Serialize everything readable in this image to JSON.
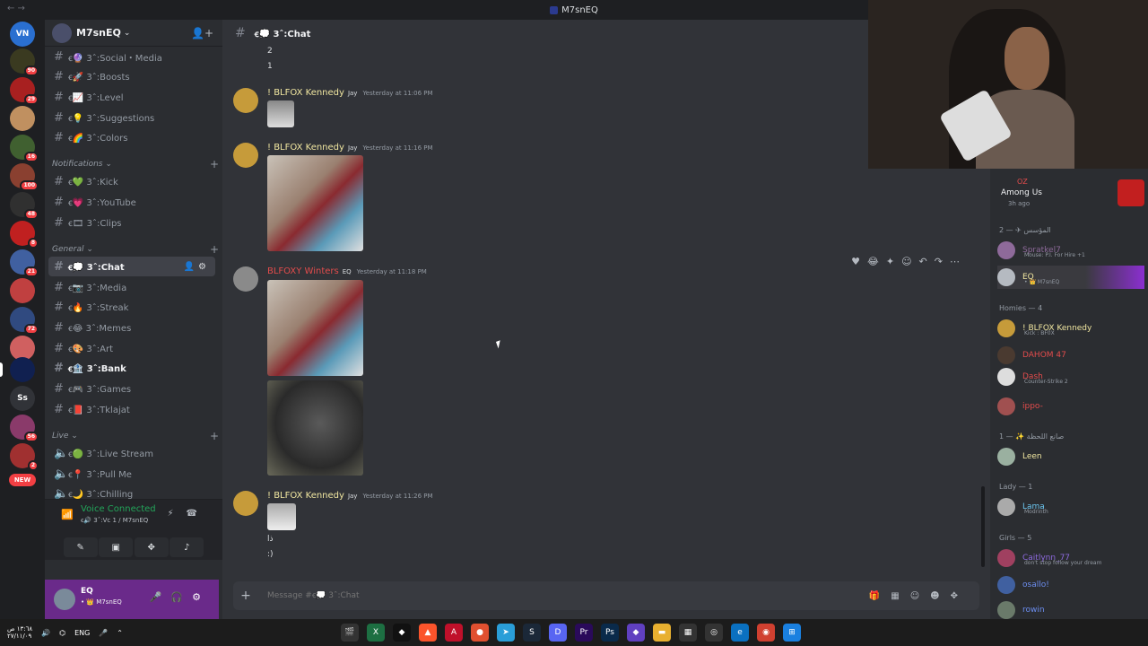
{
  "window": {
    "title": "M7snEQ"
  },
  "server": {
    "name": "M7snEQ"
  },
  "rail": {
    "badges": [
      "90",
      "29",
      "16",
      "100",
      "48",
      "8",
      "21",
      "72",
      "56",
      "2",
      "NEW"
    ],
    "ss": "Ss"
  },
  "channels": [
    {
      "name": "ꞓ🔮 3ˆ:Social・Media"
    },
    {
      "name": "ꞓ🚀 3ˆ:Boosts"
    },
    {
      "name": "ꞓ📈 3ˆ:Level"
    },
    {
      "name": "ꞓ💡 3ˆ:Suggestions"
    },
    {
      "name": "ꞓ🌈 3ˆ:Colors"
    }
  ],
  "categories": {
    "notifications": "Notifications",
    "general": "General",
    "live": "Live"
  },
  "notif_channels": [
    {
      "name": "ꞓ💚 3ˆ:Kick"
    },
    {
      "name": "ꞓ💗 3ˆ:YouTube"
    },
    {
      "name": "ꞓ🎞 3ˆ:Clips"
    }
  ],
  "general_channels": [
    {
      "name": "ꞓ💭 3ˆ:Chat"
    },
    {
      "name": "ꞓ📷 3ˆ:Media"
    },
    {
      "name": "ꞓ🔥 3ˆ:Streak"
    },
    {
      "name": "ꞓ😂 3ˆ:Memes"
    },
    {
      "name": "ꞓ🎨 3ˆ:Art"
    },
    {
      "name": "ꞓ🏦 3ˆ:Bank"
    },
    {
      "name": "ꞓ🎮 3ˆ:Games"
    },
    {
      "name": "ꞓ📕 3ˆ:Tklajat"
    }
  ],
  "live_channels": [
    {
      "name": "ꞓ🟢 3ˆ:Live Stream"
    },
    {
      "name": "ꞓ📍 3ˆ:Pull Me"
    },
    {
      "name": "ꞓ🌙 3ˆ:Chilling"
    }
  ],
  "voice": {
    "title": "Voice Connected",
    "sub": "ꞓ🔊 3ˆ:Vc 1 / M7snEQ"
  },
  "user": {
    "name": "EQ",
    "sub": "• 👑 M7snEQ"
  },
  "chat": {
    "header": "ꞓ💭 3ˆ:Chat",
    "top_lines": [
      "2",
      "1"
    ],
    "messages": [
      {
        "author": "! BLFOX Kennedy",
        "tag": "Jay",
        "time": "Yesterday at 11:06 PM"
      },
      {
        "author": "! BLFOX Kennedy",
        "tag": "Jay",
        "time": "Yesterday at 11:16 PM"
      },
      {
        "author": "BLFOXY Winters",
        "tag": "EQ",
        "time": "Yesterday at 11:18 PM"
      },
      {
        "author": "! BLFOX Kennedy",
        "tag": "Jay",
        "time": "Yesterday at 11:26 PM",
        "lines": [
          "ذا",
          ":)"
        ]
      }
    ],
    "placeholder": "Message #ꞓ💭 3ˆ:Chat"
  },
  "members": {
    "game": {
      "user": "OZ",
      "title": "Among Us",
      "ago": "3h ago"
    },
    "groups": [
      {
        "label": "المؤسس ✈ — 2",
        "items": [
          {
            "name": "Spratkel7",
            "tag": "EQ",
            "act": "Mouse: P.I. For Hire +1",
            "color": "#8e6a9a"
          },
          {
            "name": "EQ",
            "tag": "EQ",
            "act": "• 👑 M7snEQ",
            "color": "#f0e6a0"
          }
        ]
      },
      {
        "label": "Homies — 4",
        "items": [
          {
            "name": "! BLFOX Kennedy",
            "tag": "Jay",
            "act": "Kick : BF0X",
            "color": "#f0e6a0"
          },
          {
            "name": "DAHOM 47",
            "tag": "",
            "act": "",
            "color": "#e34c4c"
          },
          {
            "name": "Dash",
            "tag": "",
            "act": "Counter-Strike 2",
            "color": "#e34c4c"
          },
          {
            "name": "ippo-",
            "tag": "",
            "act": "",
            "color": "#e34c4c"
          }
        ]
      },
      {
        "label": "صانع اللحظة ✨ — 1",
        "items": [
          {
            "name": "Leen",
            "tag": "EQ",
            "act": "",
            "color": "#f0e6a0"
          }
        ]
      },
      {
        "label": "Lady — 1",
        "items": [
          {
            "name": "Lama",
            "tag": "nmo",
            "act": "Modrinth",
            "color": "#6cc6f0"
          }
        ]
      },
      {
        "label": "Girls — 5",
        "items": [
          {
            "name": "Caitlynn_77",
            "tag": "TFT",
            "act": "don't stop follow your dream",
            "color": "#8e6adf"
          },
          {
            "name": "osallo!",
            "tag": "KSA",
            "act": "",
            "color": "#6c8ef0"
          },
          {
            "name": "rowin",
            "tag": "",
            "act": "",
            "color": "#6c8ef0"
          }
        ]
      }
    ]
  },
  "taskbar": {
    "time": "١٣:٦٨ ص",
    "date": "٢٧/١١/٠٩",
    "lang": "ENG"
  }
}
